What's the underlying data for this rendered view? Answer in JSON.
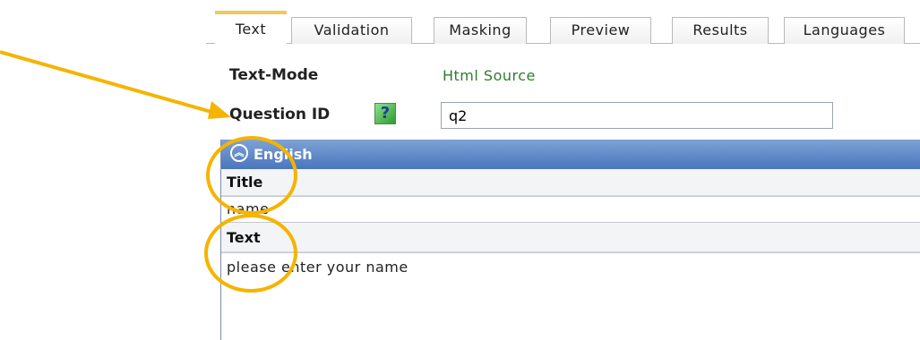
{
  "tabs": [
    {
      "label": "Text",
      "active": true
    },
    {
      "label": "Validation"
    },
    {
      "label": "Masking"
    },
    {
      "label": "Preview"
    },
    {
      "label": "Results"
    },
    {
      "label": "Languages"
    }
  ],
  "text_mode": {
    "label": "Text-Mode",
    "value": "Html Source"
  },
  "question_id": {
    "label": "Question ID",
    "help_glyph": "?",
    "value": "q2"
  },
  "panel": {
    "language": "English",
    "title_label": "Title",
    "title_value": "name",
    "text_label": "Text",
    "text_value": "please enter your name"
  },
  "colors": {
    "tab_active_accent": "#f2c75c",
    "panel_header": "#4a76bd",
    "annotation": "#f5b400",
    "text_mode_value": "#2e7d2e"
  },
  "icons": {
    "help": "question-help-icon",
    "collapse": "chevron-up-circle-icon"
  }
}
